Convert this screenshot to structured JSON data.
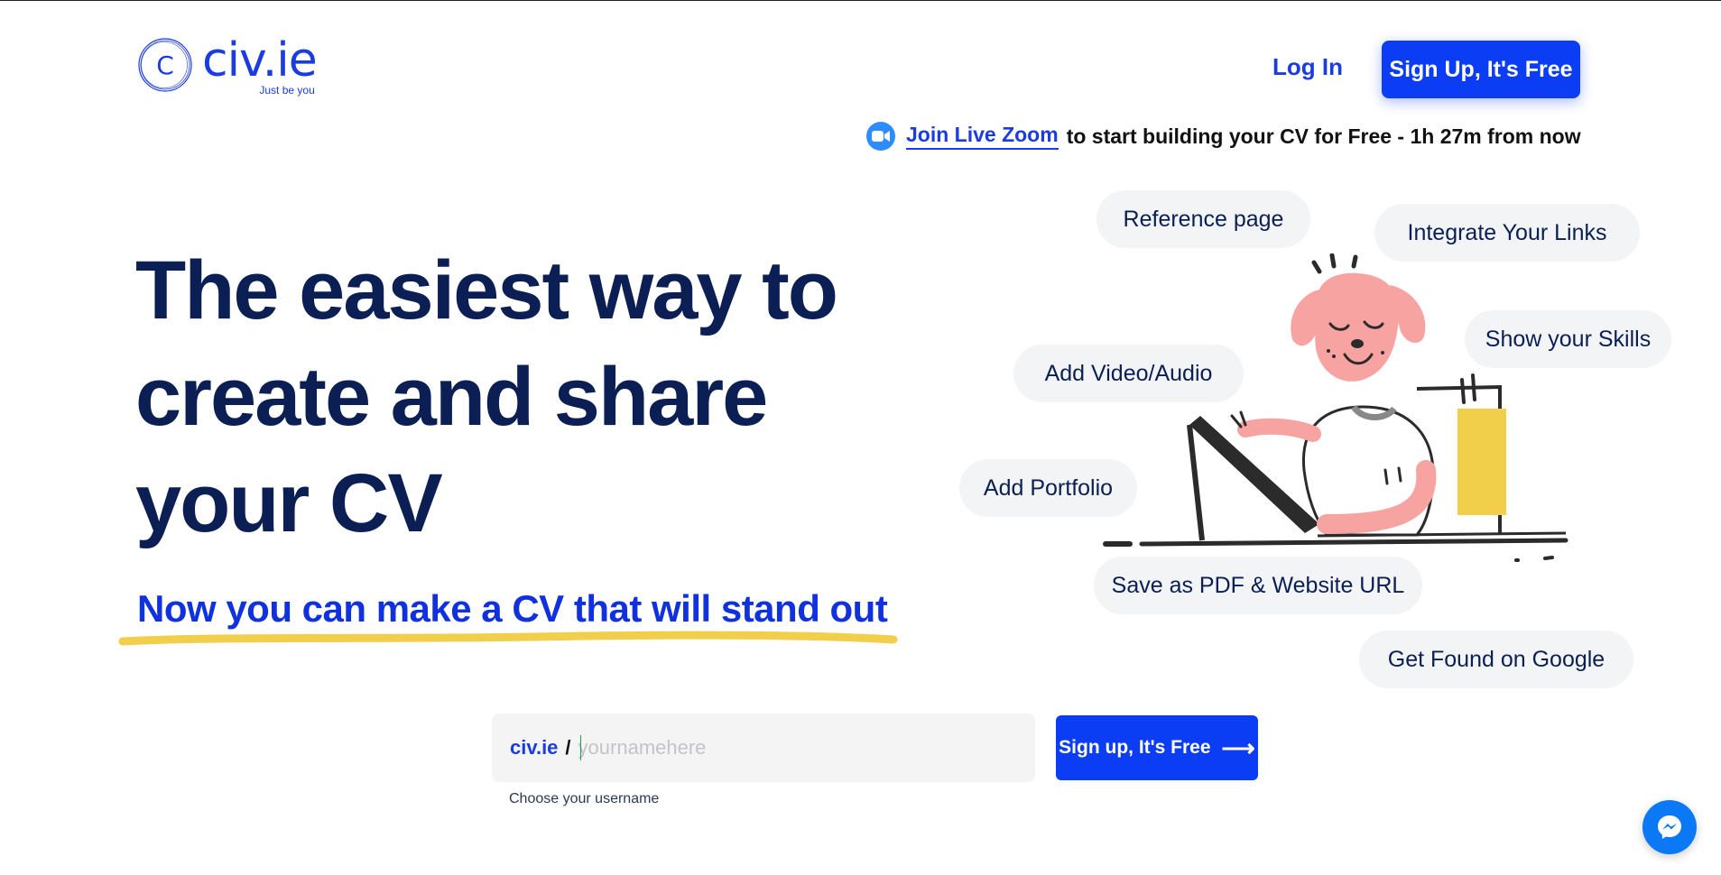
{
  "brand": {
    "logo_letter": "C",
    "logo_word": "civ.ie",
    "tagline": "Just be you",
    "accent_color": "#1a3ce0",
    "button_color": "#0b3df5"
  },
  "nav": {
    "login_label": "Log In",
    "signup_label": "Sign Up, It's Free"
  },
  "announcement": {
    "icon": "zoom-camera-icon",
    "link_label": "Join Live Zoom",
    "text": "to start building your CV for Free - 1h 27m from now"
  },
  "hero": {
    "title": "The easiest way to create and share your CV",
    "subtitle": "Now you can make a CV that will stand out"
  },
  "features": [
    "Reference page",
    "Integrate Your Links",
    "Show your Skills",
    "Add Video/Audio",
    "Add Portfolio",
    "Save as PDF & Website URL",
    "Get Found on Google"
  ],
  "signup_form": {
    "prefix": "civ.ie",
    "separator": "/",
    "input_value": "",
    "input_placeholder": "yournamehere",
    "helper_text": "Choose your username",
    "button_label": "Sign up, It's Free",
    "button_arrow": "⟶"
  },
  "chat": {
    "icon": "messenger-icon"
  }
}
